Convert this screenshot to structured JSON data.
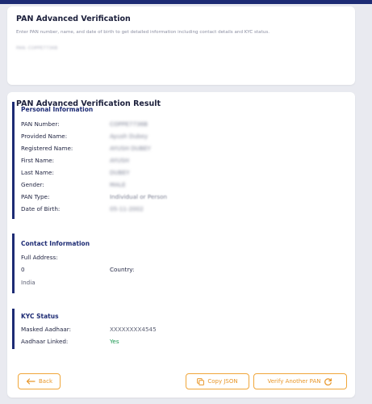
{
  "verify_card": {
    "title": "PAN Advanced Verification",
    "description": "Enter PAN number, name, and date of birth to get detailed information including contact details and KYC status.",
    "pan_field_text": "PAN: COPPE7736B"
  },
  "result_card": {
    "title": "PAN Advanced Verification Result"
  },
  "personal": {
    "title": "Personal Information",
    "rows": [
      {
        "label": "PAN Number:",
        "value": "COPPE7736B"
      },
      {
        "label": "Provided Name:",
        "value": "Ayush Dubey"
      },
      {
        "label": "Registered Name:",
        "value": "AYUSH DUBEY"
      },
      {
        "label": "First Name:",
        "value": "AYUSH"
      },
      {
        "label": "Last Name:",
        "value": "DUBEY"
      },
      {
        "label": "Gender:",
        "value": "MALE"
      },
      {
        "label": "PAN Type:",
        "value": "Individual or Person"
      },
      {
        "label": "Date of Birth:",
        "value": "05-11-2002"
      }
    ]
  },
  "contact": {
    "title": "Contact Information",
    "full_address_label": "Full Address:",
    "address_value": "0",
    "country_label": "Country:",
    "country_value": "India"
  },
  "kyc": {
    "title": "KYC Status",
    "masked_aadhaar_label": "Masked Aadhaar:",
    "masked_aadhaar_value": "XXXXXXXX4545",
    "aadhaar_linked_label": "Aadhaar Linked:",
    "aadhaar_linked_value": "Yes"
  },
  "actions": {
    "back_label": "Back",
    "copy_label": "Copy JSON",
    "verify_again_label": "Verify Another PAN"
  },
  "colors": {
    "accent": "#f0a63a",
    "navy": "#1d2b74",
    "success": "#1f9a55",
    "background": "#e9eaf0"
  }
}
